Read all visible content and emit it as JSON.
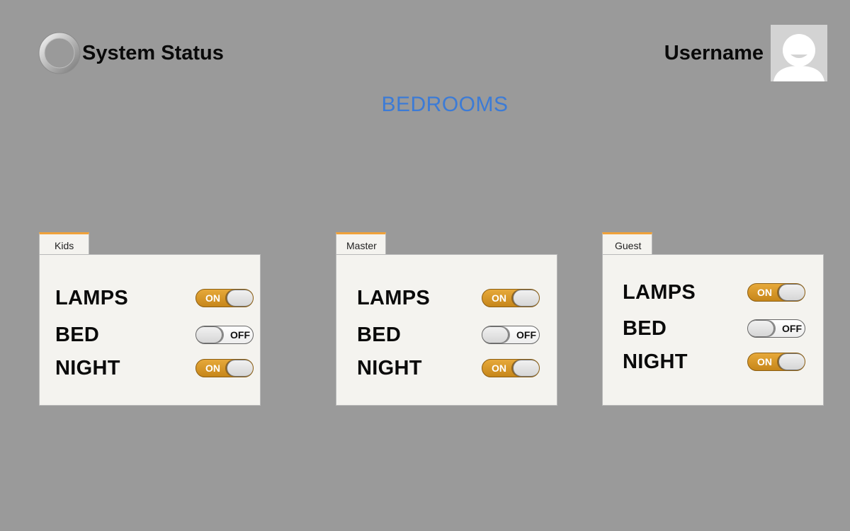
{
  "header": {
    "status_title": "System Status",
    "username": "Username",
    "status_icon": "spinner-ring-icon",
    "avatar_icon": "user-avatar-icon"
  },
  "page": {
    "title": "BEDROOMS"
  },
  "colors": {
    "background": "#9a9a9a",
    "title_blue": "#3c7bd6",
    "panel": "#f4f3ef",
    "tab_accent": "#f0a23a",
    "toggle_on": "#d99a2b"
  },
  "toggle_labels": {
    "on": "ON",
    "off": "OFF"
  },
  "rooms": [
    {
      "name": "Kids",
      "controls": [
        {
          "label": "LAMPS",
          "state": "on"
        },
        {
          "label": "BED",
          "state": "off"
        },
        {
          "label": "NIGHT",
          "state": "on"
        }
      ]
    },
    {
      "name": "Master",
      "controls": [
        {
          "label": "LAMPS",
          "state": "on"
        },
        {
          "label": "BED",
          "state": "off"
        },
        {
          "label": "NIGHT",
          "state": "on"
        }
      ]
    },
    {
      "name": "Guest",
      "controls": [
        {
          "label": "LAMPS",
          "state": "on"
        },
        {
          "label": "BED",
          "state": "off"
        },
        {
          "label": "NIGHT",
          "state": "on"
        }
      ]
    }
  ]
}
